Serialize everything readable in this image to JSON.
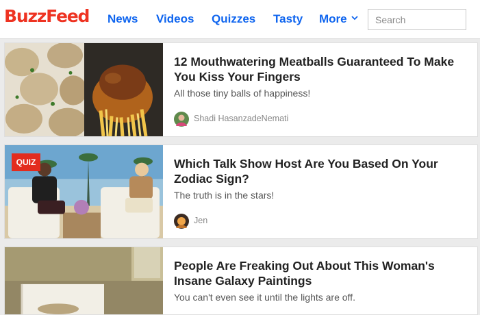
{
  "brand": {
    "logo_text": "BuzzFeed",
    "logo_color": "#ee3322"
  },
  "nav": {
    "items": [
      {
        "label": "News"
      },
      {
        "label": "Videos"
      },
      {
        "label": "Quizzes"
      },
      {
        "label": "Tasty"
      },
      {
        "label": "More"
      }
    ],
    "link_color": "#0f65ef",
    "more_icon": "chevron-down-icon"
  },
  "search": {
    "placeholder": "Search",
    "value": ""
  },
  "feed": [
    {
      "title": "12 Mouthwatering Meatballs Guaranteed To Make You Kiss Your Fingers",
      "description": "All those tiny balls of happiness!",
      "author": "Shadi HasanzadeNemati",
      "badge": ""
    },
    {
      "title": "Which Talk Show Host Are You Based On Your Zodiac Sign?",
      "description": "The truth is in the stars!",
      "author": "Jen",
      "badge": "QUIZ"
    },
    {
      "title": "People Are Freaking Out About This Woman's Insane Galaxy Paintings",
      "description": "You can't even see it until the lights are off.",
      "author": "",
      "badge": ""
    }
  ],
  "badge_color": "#e32c1e"
}
